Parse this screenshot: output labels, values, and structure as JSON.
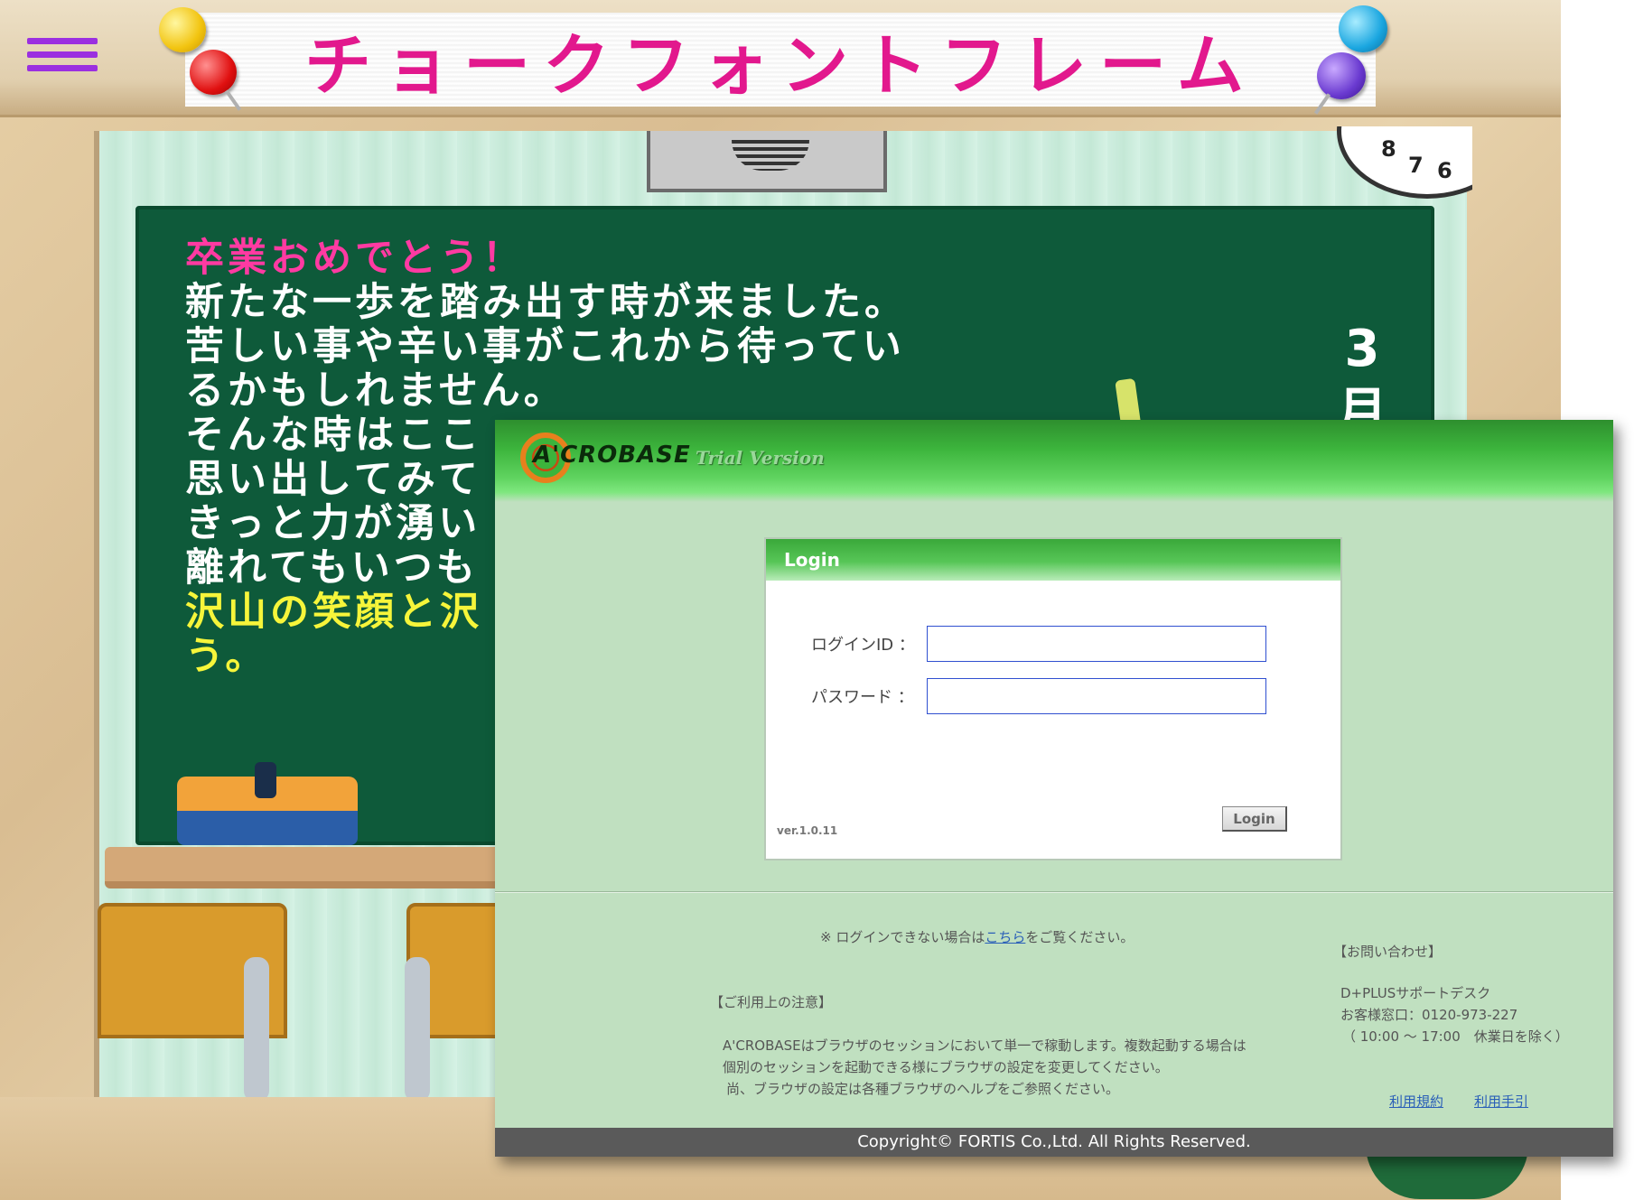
{
  "background_page": {
    "title": "チョークフォントフレーム",
    "blackboard": {
      "heading": "卒業おめでとう！",
      "lines": [
        "新たな一歩を踏み出す時が来ました。",
        "苦しい事や辛い事がこれから待ってい",
        "るかもしれません。",
        "そんな時はここ",
        "思い出してみて",
        "きっと力が湧い",
        "離れてもいつも"
      ],
      "highlight_lines": [
        "沢山の笑顔と沢",
        "う。"
      ],
      "side_date": [
        "3",
        "月"
      ]
    },
    "clock_numbers": [
      "8",
      "7",
      "6"
    ],
    "colors": {
      "title": "#e2188d",
      "menu": "#9b2fe0",
      "board": "#0e5a3a"
    }
  },
  "acrobase": {
    "logo": "A'CROBASE",
    "edition": "Trial Version",
    "login_panel": {
      "title": "Login",
      "id_label": "ログインID ：",
      "id_value": "",
      "password_label": "パスワード ：",
      "password_value": "",
      "version": "ver.1.0.11",
      "button": "Login"
    },
    "help_text_prefix": "※ ログインできない場合は",
    "help_link": "こちら",
    "help_text_suffix": "をご覧ください。",
    "notice": {
      "heading": "【ご利用上の注意】",
      "lines": [
        "A'CROBASEはブラウザのセッションにおいて単一で稼動します。複数起動する場合は",
        "個別のセッションを起動できる様にブラウザの設定を変更してください。",
        "尚、ブラウザの設定は各種ブラウザのヘルプをご参照ください。"
      ]
    },
    "contact": {
      "heading": "【お問い合わせ】",
      "name": "D+PLUSサポートデスク",
      "phone": "お客様窓口：0120-973-227",
      "hours": "（ 10:00 ～ 17:00　休業日を除く）"
    },
    "links": {
      "terms": "利用規約",
      "manual": "利用手引"
    },
    "copyright": "Copyright© FORTIS Co.,Ltd. All Rights Reserved.",
    "colors": {
      "header": "#3cb43c",
      "body": "#c0e0c0",
      "footer": "#5a5a5a",
      "link": "#2a5fb8"
    }
  }
}
